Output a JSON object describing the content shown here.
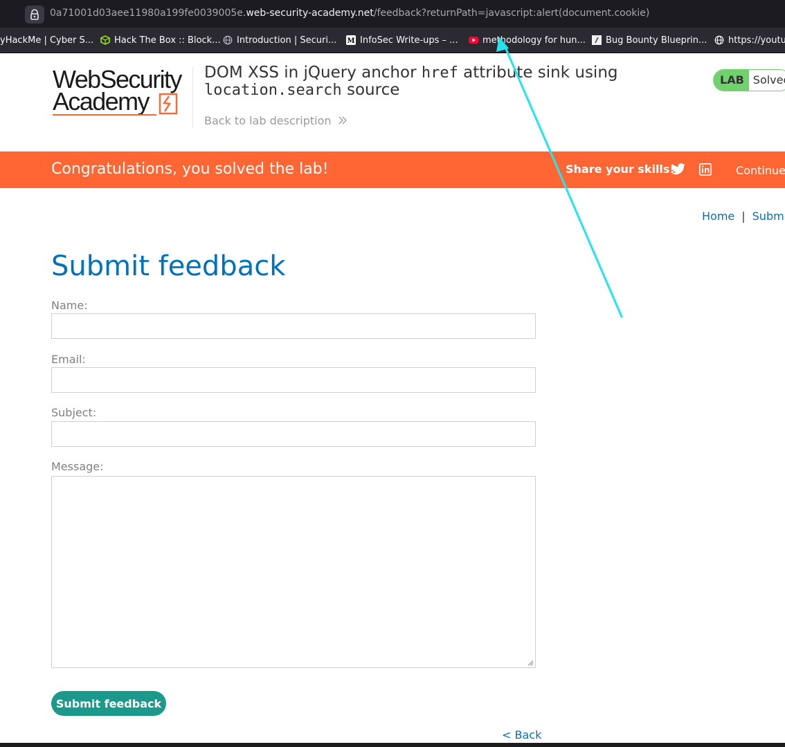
{
  "browser": {
    "url_prefix": "0a71001d03aee11980a199fe0039005e.",
    "url_host": "web-security-academy.net",
    "url_path": "/feedback?returnPath=javascript:alert(document.cookie)",
    "bookmarks": [
      {
        "label": "yHackMe | Cyber S...",
        "icon": "none"
      },
      {
        "label": "Hack The Box :: Block...",
        "icon": "hackthebox-icon"
      },
      {
        "label": "Introduction | Securi...",
        "icon": "globe-icon"
      },
      {
        "label": "InfoSec Write-ups – ...",
        "icon": "medium-icon"
      },
      {
        "label": "methodology for hun...",
        "icon": "youtube-icon"
      },
      {
        "label": "Bug Bounty Blueprin...",
        "icon": "page-icon"
      },
      {
        "label": "https://youtu",
        "icon": "globe-icon"
      }
    ]
  },
  "lab": {
    "logo_line1": "WebSecurity",
    "logo_line2": "Academy",
    "title_part1": "DOM XSS in jQuery anchor ",
    "title_code1": "href",
    "title_part2": " attribute sink using ",
    "title_code2": "location.search",
    "title_part3": " source",
    "back_to_description": "Back to lab description",
    "badge_label": "LAB",
    "badge_status": "Solved"
  },
  "banner": {
    "message": "Congratulations, you solved the lab!",
    "share": "Share your skills!",
    "continue": "Continue"
  },
  "breadcrumbs": {
    "home": "Home",
    "separator": "|",
    "current": "Submi"
  },
  "form": {
    "heading": "Submit feedback",
    "name_label": "Name:",
    "email_label": "Email:",
    "subject_label": "Subject:",
    "message_label": "Message:",
    "submit_label": "Submit feedback",
    "back_link": "< Back"
  },
  "colors": {
    "accent_orange": "#ff6633",
    "link_blue": "#0071bc",
    "submit_green": "#1b998b",
    "solved_green": "#70d16d",
    "annotation_arrow": "#22e5ef"
  }
}
